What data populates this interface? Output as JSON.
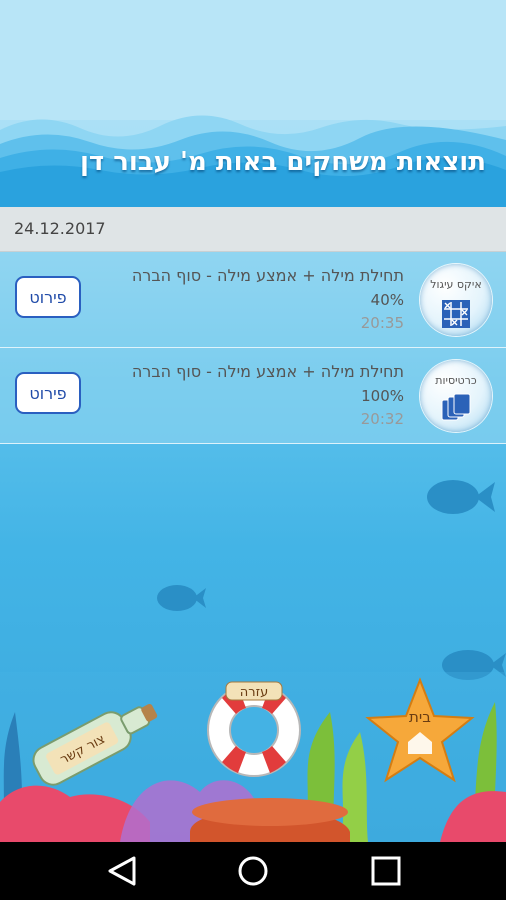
{
  "header": {
    "title": "תוצאות משחקים באות מ' עבור דן"
  },
  "date": "24.12.2017",
  "results": [
    {
      "icon_label": "איקס עיגול",
      "description": "תחילת מילה + אמצע מילה - סוף הברה",
      "score": "40%",
      "time": "20:35",
      "details_label": "פירוט"
    },
    {
      "icon_label": "כרטיסיות",
      "description": "תחילת מילה + אמצע מילה - סוף הברה",
      "score": "100%",
      "time": "20:32",
      "details_label": "פירוט"
    }
  ],
  "bottom": {
    "bottle_label": "צור קשר",
    "lifebuoy_label": "עזרה",
    "star_label": "בית"
  },
  "navbar": {
    "back": "back-icon",
    "home": "circle-home-icon",
    "recents": "square-recents-icon"
  },
  "colors": {
    "header_text": "#ffffff",
    "date_bar": "#dfe4e6",
    "button_border": "#2a5fc0",
    "navbar": "#000000"
  }
}
